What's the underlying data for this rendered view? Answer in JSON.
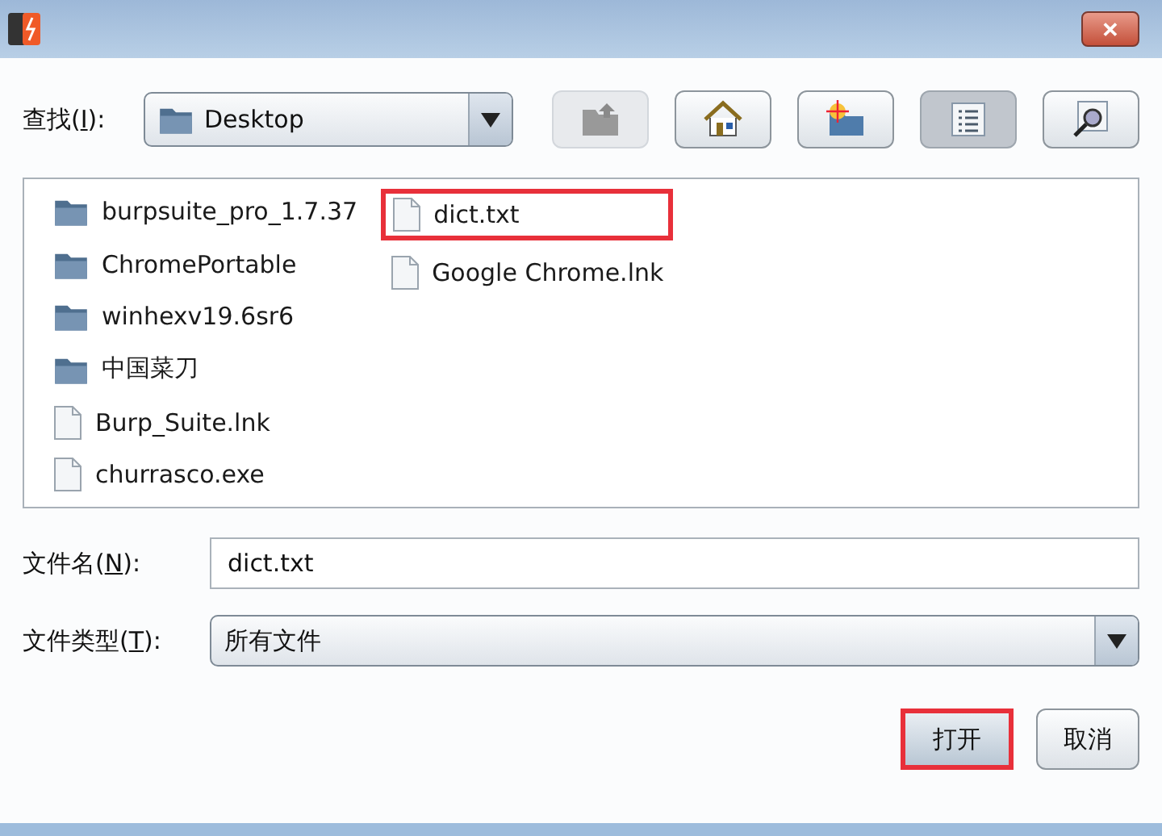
{
  "window": {
    "close": "✕"
  },
  "look_in": {
    "label_before": "查找(",
    "mnemonic": "I",
    "label_after": "):",
    "value": "Desktop"
  },
  "toolbar": [
    {
      "kind": "up",
      "disabled": true,
      "selected": false
    },
    {
      "kind": "home",
      "disabled": false,
      "selected": false
    },
    {
      "kind": "newfolder",
      "disabled": false,
      "selected": false
    },
    {
      "kind": "list",
      "disabled": false,
      "selected": true
    },
    {
      "kind": "details",
      "disabled": false,
      "selected": false
    }
  ],
  "files": [
    [
      {
        "name": "burpsuite_pro_1.7.37",
        "kind": "folder",
        "highlighted": false
      },
      {
        "name": "ChromePortable",
        "kind": "folder",
        "highlighted": false
      },
      {
        "name": "winhexv19.6sr6",
        "kind": "folder",
        "highlighted": false
      },
      {
        "name": "中国菜刀",
        "kind": "folder",
        "highlighted": false
      },
      {
        "name": "Burp_Suite.lnk",
        "kind": "file",
        "highlighted": false
      },
      {
        "name": "churrasco.exe",
        "kind": "file",
        "highlighted": false
      }
    ],
    [
      {
        "name": "dict.txt",
        "kind": "file",
        "highlighted": true
      },
      {
        "name": "Google Chrome.lnk",
        "kind": "file",
        "highlighted": false
      }
    ]
  ],
  "file_name": {
    "label_before": "文件名(",
    "mnemonic": "N",
    "label_after": "):",
    "value": "dict.txt"
  },
  "file_type": {
    "label_before": "文件类型(",
    "mnemonic": "T",
    "label_after": "):",
    "value": "所有文件"
  },
  "buttons": [
    {
      "label": "打开",
      "highlighted": true
    },
    {
      "label": "取消",
      "highlighted": false
    }
  ]
}
